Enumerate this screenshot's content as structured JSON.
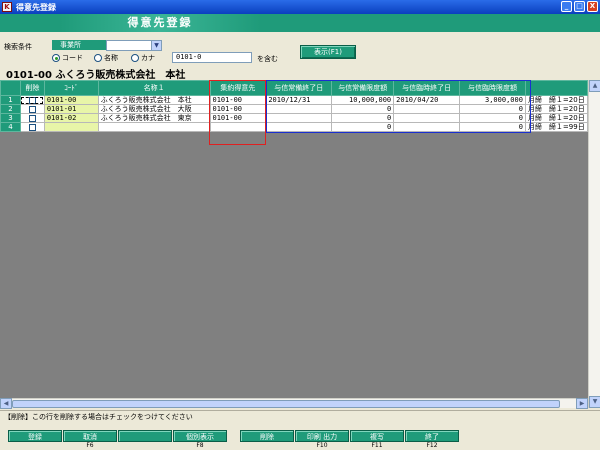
{
  "window": {
    "title": "得意先登録",
    "min": "_",
    "max": "□",
    "close": "X"
  },
  "form": {
    "title": "得意先登録"
  },
  "search": {
    "condition_label": "検索条件",
    "office_label": "事業所",
    "office_value": "",
    "radio_code": "コード",
    "radio_name": "名称",
    "radio_kana": "カナ",
    "keyword": "0101-0",
    "contains": "を含む",
    "show_button": "表示(F1)"
  },
  "subtitle": "0101-00 ふくろう販売株式会社　本社",
  "grid": {
    "headers": {
      "delete": "削除",
      "code": "ｺｰﾄﾞ",
      "name": "名称１",
      "aggregate": "集約得意先",
      "ordinary_end": "与信常備終了日",
      "ordinary_limit": "与信常備限度額",
      "temp_end": "与信臨時終了日",
      "temp_limit": "与信臨時限度額"
    },
    "rows": [
      {
        "no": "1",
        "code": "0101-00",
        "name": "ふくろう販売株式会社　本社",
        "aggregate": "0101-00",
        "ordinary_end": "2010/12/31",
        "ordinary_limit": "10,000,000",
        "temp_end": "2010/04/20",
        "temp_limit": "3,000,000",
        "extra": "月締　締１=20日"
      },
      {
        "no": "2",
        "code": "0101-01",
        "name": "ふくろう販売株式会社　大阪",
        "aggregate": "0101-00",
        "ordinary_end": "",
        "ordinary_limit": "0",
        "temp_end": "",
        "temp_limit": "0",
        "extra": "月締　締１=20日"
      },
      {
        "no": "3",
        "code": "0101-02",
        "name": "ふくろう販売株式会社　東京",
        "aggregate": "0101-00",
        "ordinary_end": "",
        "ordinary_limit": "0",
        "temp_end": "",
        "temp_limit": "0",
        "extra": "月締　締１=20日"
      },
      {
        "no": "4",
        "code": "",
        "name": "",
        "aggregate": "",
        "ordinary_end": "",
        "ordinary_limit": "0",
        "temp_end": "",
        "temp_limit": "0",
        "extra": "月締　締１=99日"
      }
    ]
  },
  "status": "【削除】この行を削除する場合はチェックをつけてください",
  "fkeys": [
    {
      "label": "登録",
      "key": ""
    },
    {
      "label": "取消",
      "key": "F6"
    },
    {
      "label": "",
      "key": ""
    },
    {
      "label": "個別表示",
      "key": "F8"
    },
    {
      "label": "削除",
      "key": ""
    },
    {
      "label": "印刷 出力",
      "key": "F10"
    },
    {
      "label": "複写",
      "key": "F11"
    },
    {
      "label": "終了",
      "key": "F12"
    }
  ],
  "colors": {
    "accent": "#1f9b7a",
    "highlight_red": "#e02020",
    "highlight_blue": "#1a2fd0",
    "code_cell": "#e8f5a8"
  }
}
